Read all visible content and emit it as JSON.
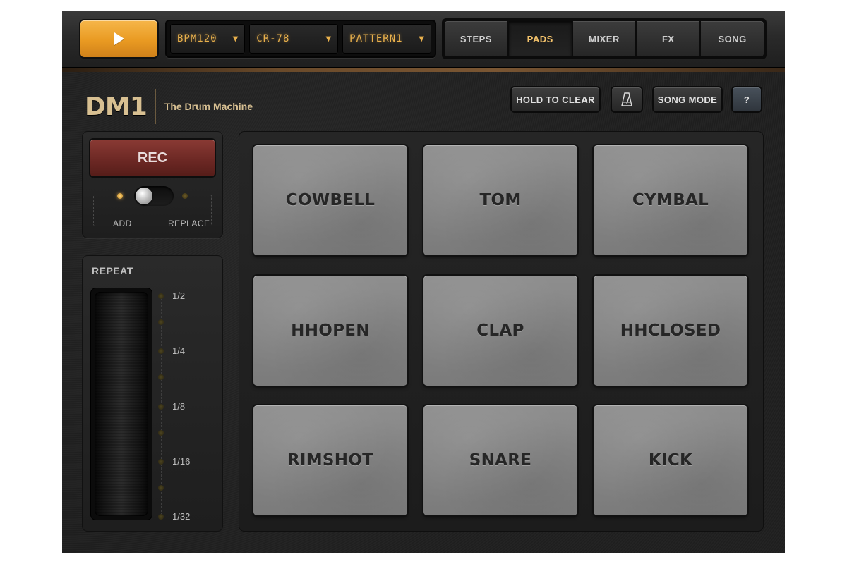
{
  "colors": {
    "accent_orange": "#e99a22",
    "lcd_amber": "#e8b04c",
    "rec_red": "#6a2723",
    "pad_gray": "#848484",
    "brand_gold": "#d8c092"
  },
  "transport": {
    "play_icon": "play-icon"
  },
  "lcd": {
    "bpm": "BPM120",
    "kit": "CR-78",
    "pattern": "PATTERN1"
  },
  "tabs": [
    {
      "label": "STEPS",
      "active": false
    },
    {
      "label": "PADS",
      "active": true
    },
    {
      "label": "MIXER",
      "active": false
    },
    {
      "label": "FX",
      "active": false
    },
    {
      "label": "SONG",
      "active": false
    }
  ],
  "brand": {
    "logo": "DM1",
    "subtitle": "The Drum Machine"
  },
  "header_buttons": {
    "hold_to_clear": "HOLD TO CLEAR",
    "metronome_icon": "metronome-icon",
    "song_mode": "SONG MODE",
    "help": "?"
  },
  "record": {
    "rec_label": "REC",
    "mode_add": "ADD",
    "mode_replace": "REPLACE",
    "selected_mode": "ADD"
  },
  "repeat": {
    "title": "REPEAT",
    "options": [
      "1/2",
      "1/4",
      "1/8",
      "1/16",
      "1/32"
    ]
  },
  "pads": [
    "COWBELL",
    "TOM",
    "CYMBAL",
    "HHOPEN",
    "CLAP",
    "HHCLOSED",
    "RIMSHOT",
    "SNARE",
    "KICK"
  ]
}
